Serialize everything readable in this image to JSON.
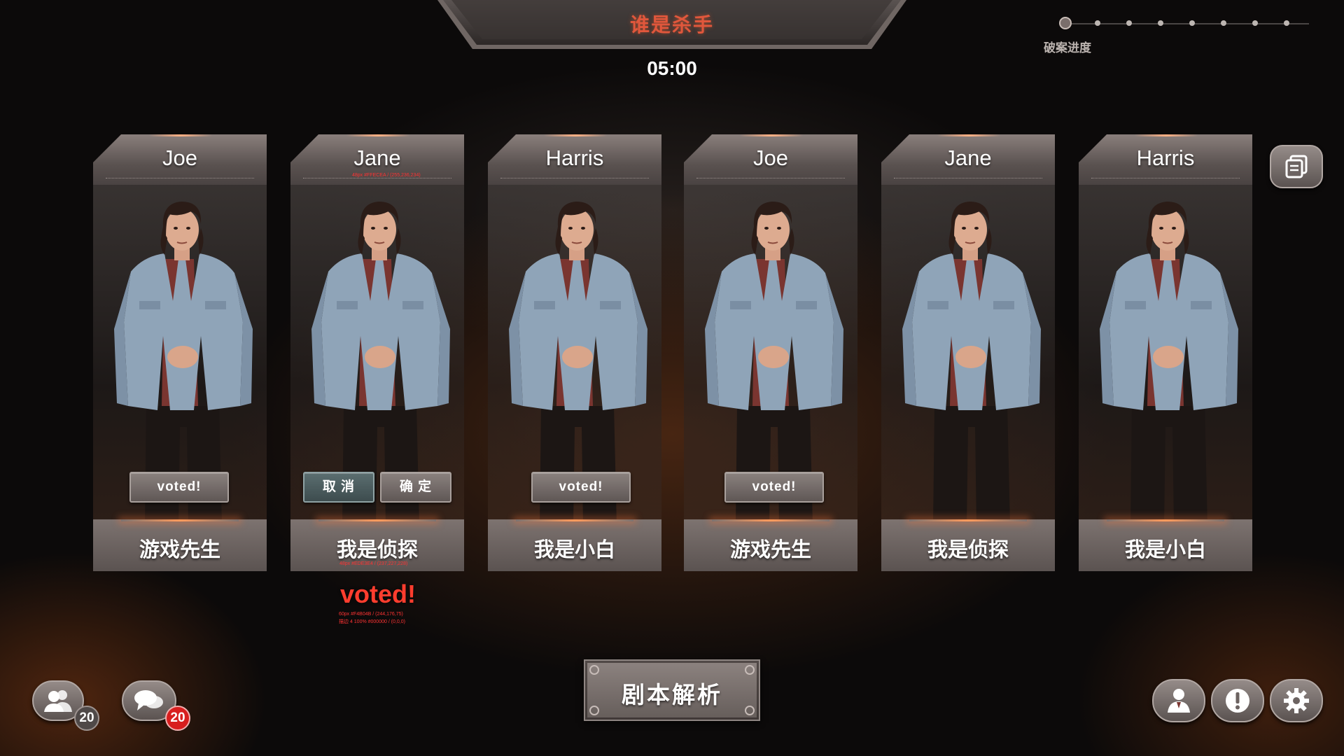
{
  "header": {
    "title": "谁是杀手",
    "timer": "05:00"
  },
  "progress": {
    "label": "破案进度",
    "current_step": 1,
    "total_steps": 8
  },
  "cards": [
    {
      "name": "Joe",
      "role": "游戏先生",
      "button": "voted!"
    },
    {
      "name": "Jane",
      "role": "我是侦探",
      "cancel": "取 消",
      "confirm": "确 定",
      "annotation_name": "48px #FFECEA / (255,236,234)",
      "annotation_role": "48px #EDE3E4 / (237,227,228)"
    },
    {
      "name": "Harris",
      "role": "我是小白",
      "button": "voted!"
    },
    {
      "name": "Joe",
      "role": "游戏先生",
      "button": "voted!"
    },
    {
      "name": "Jane",
      "role": "我是侦探"
    },
    {
      "name": "Harris",
      "role": "我是小白"
    }
  ],
  "vote_label": {
    "text": "voted!",
    "annotation_1": "60px #F4B04B / (244,176,75)",
    "annotation_2": "描边 4 100% #000000 / (0,0,0)"
  },
  "analysis_button": "剧本解析",
  "badges": {
    "players_count": "20",
    "chat_count": "20"
  },
  "colors": {
    "title": "#e0573c",
    "vote_label": "#ff3d2e",
    "chat_badge": "#d81e1e"
  },
  "icons": [
    "players-icon",
    "chat-icon",
    "host-icon",
    "alert-icon",
    "settings-icon",
    "notes-icon"
  ]
}
